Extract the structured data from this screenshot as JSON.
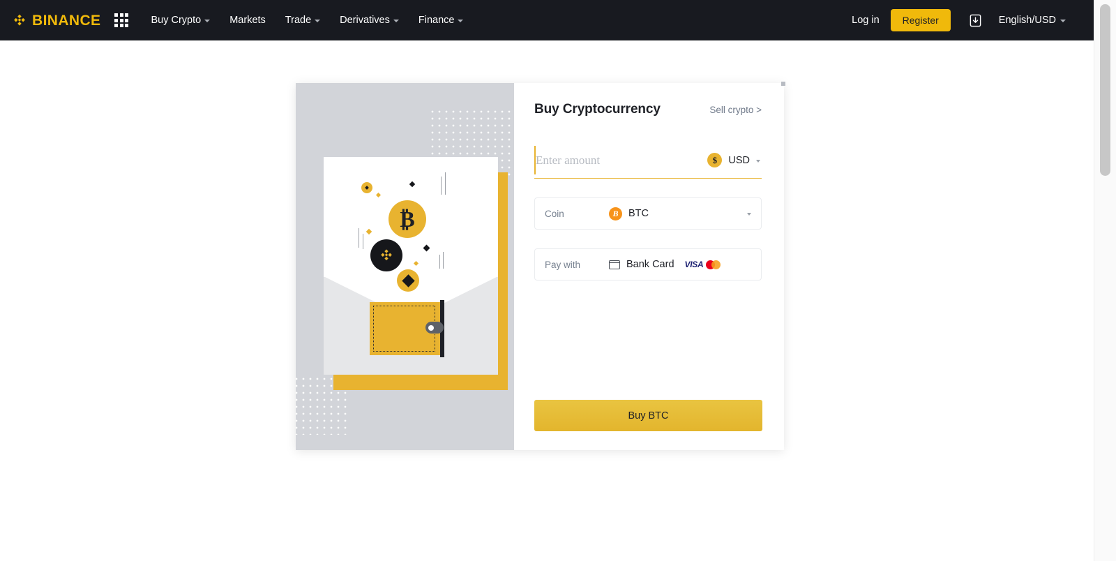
{
  "navbar": {
    "brand": "BINANCE",
    "brand_color": "#f0b90b",
    "background_color": "#181a20",
    "apps_icon": "grid-apps-icon",
    "links": [
      {
        "label": "Buy Crypto",
        "has_caret": true
      },
      {
        "label": "Markets",
        "has_caret": false
      },
      {
        "label": "Trade",
        "has_caret": true
      },
      {
        "label": "Derivatives",
        "has_caret": true
      },
      {
        "label": "Finance",
        "has_caret": true
      }
    ],
    "login_label": "Log in",
    "register_label": "Register",
    "download_icon": "download-app-icon",
    "language": "English/USD"
  },
  "card": {
    "title": "Buy Cryptocurrency",
    "sell_link": "Sell crypto >",
    "amount": {
      "placeholder": "Enter amount",
      "value": "",
      "currency_symbol": "$",
      "currency_code": "USD"
    },
    "coin_field": {
      "label": "Coin",
      "value": "BTC",
      "icon": "bitcoin-icon",
      "icon_color": "#f7931a"
    },
    "pay_field": {
      "label": "Pay with",
      "value": "Bank Card",
      "icon": "credit-card-icon",
      "logos": [
        "VISA",
        "mastercard-logo"
      ]
    },
    "submit_label": "Buy BTC",
    "submit_color": "#e8c33e"
  },
  "illustration": {
    "name": "crypto-wallet-illustration",
    "background_color": "#d2d4d9",
    "accent_color": "#e8b330",
    "coins": [
      "bitcoin-coin",
      "binance-coin",
      "diamond-coin"
    ]
  }
}
